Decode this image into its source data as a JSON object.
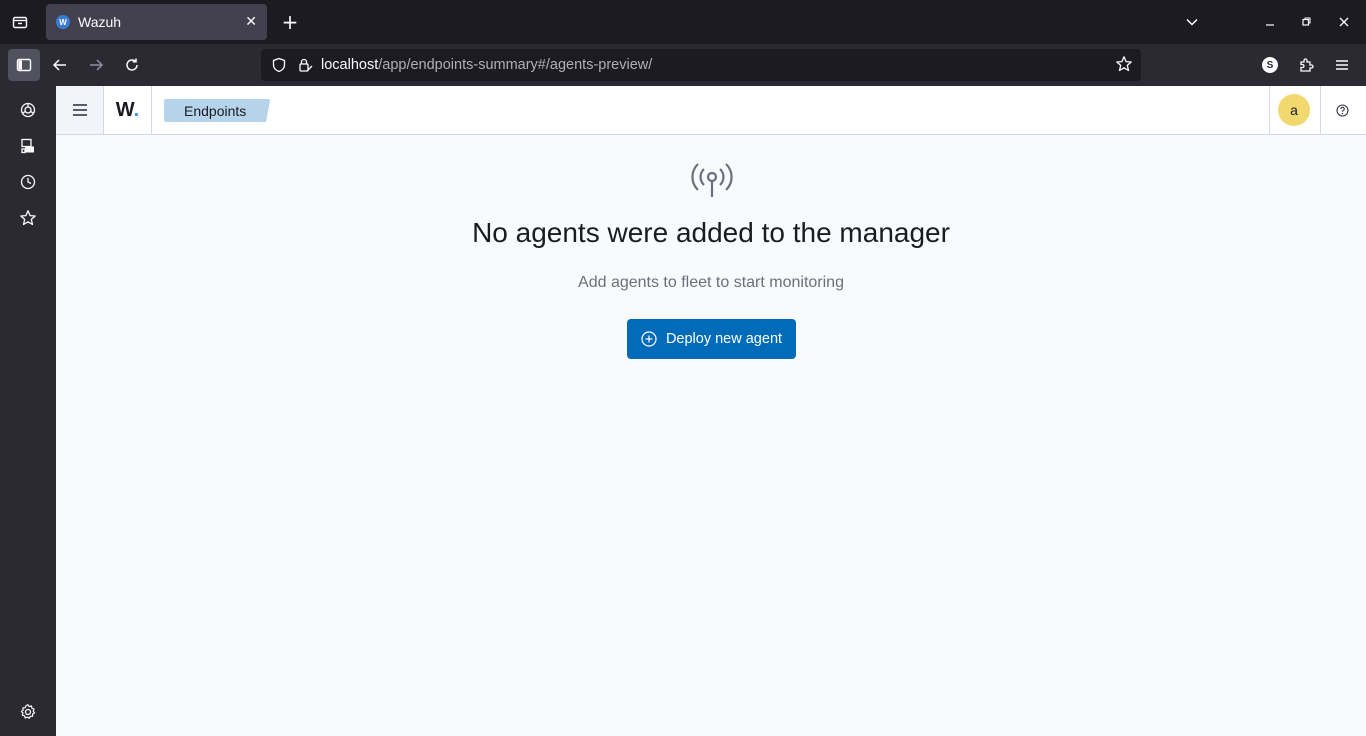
{
  "browser": {
    "tab": {
      "title": "Wazuh",
      "favicon_letter": "W"
    },
    "url": {
      "host": "localhost",
      "path": "/app/endpoints-summary#/agents-preview/"
    },
    "profile_initial": "S"
  },
  "app": {
    "logo": {
      "text": "W",
      "dot": "."
    },
    "breadcrumb": "Endpoints",
    "user_initial": "a"
  },
  "empty_state": {
    "title": "No agents were added to the manager",
    "subtitle": "Add agents to fleet to start monitoring",
    "button_label": "Deploy new agent"
  },
  "colors": {
    "primary": "#006bb8",
    "breadcrumb_bg": "#b6d3ec",
    "avatar_bg": "#f1d86f"
  }
}
